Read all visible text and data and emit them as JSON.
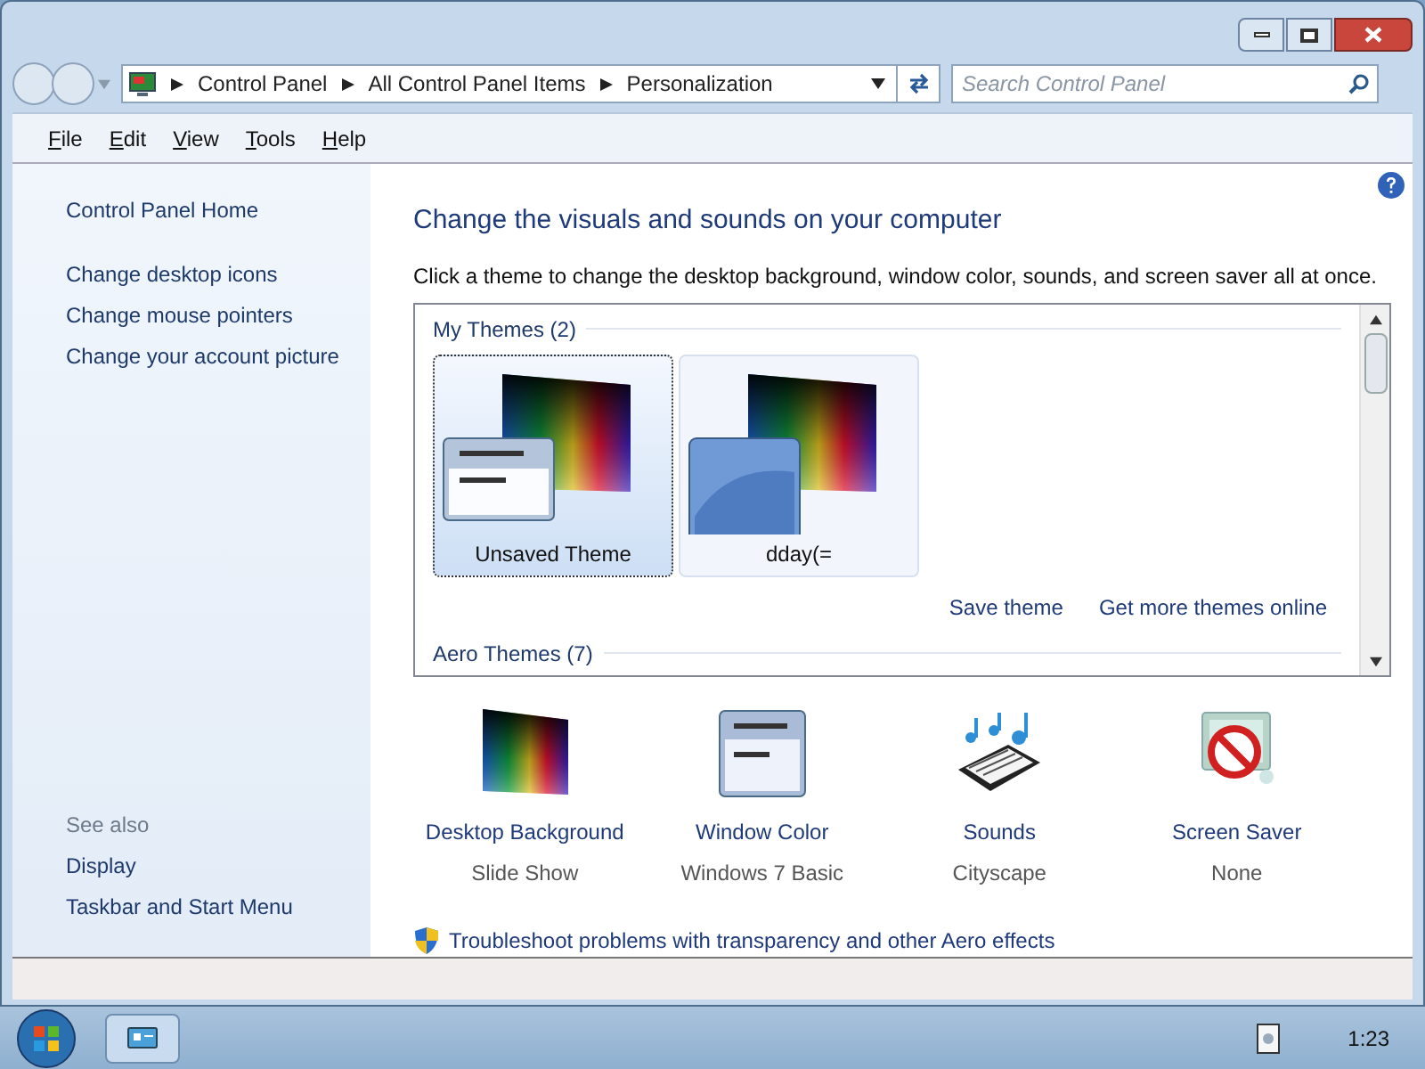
{
  "address_bar": {
    "breadcrumbs": [
      "Control Panel",
      "All Control Panel Items",
      "Personalization"
    ]
  },
  "search": {
    "placeholder": "Search Control Panel"
  },
  "menu": [
    "File",
    "Edit",
    "View",
    "Tools",
    "Help"
  ],
  "sidebar": {
    "links": [
      "Control Panel Home",
      "Change desktop icons",
      "Change mouse pointers",
      "Change your account picture"
    ],
    "see_also_title": "See also",
    "see_also": [
      "Display",
      "Taskbar and Start Menu"
    ]
  },
  "heading": "Change the visuals and sounds on your computer",
  "instruction": "Click a theme to change the desktop background, window color, sounds, and screen saver all at once.",
  "theme_groups": [
    {
      "title": "My Themes (2)",
      "themes": [
        {
          "name": "Unsaved Theme",
          "selected": true,
          "kind": "basic"
        },
        {
          "name": "dday(=",
          "selected": false,
          "kind": "aero"
        }
      ]
    },
    {
      "title": "Aero Themes (7)"
    }
  ],
  "theme_links": [
    "Save theme",
    "Get more themes online"
  ],
  "settings": [
    {
      "kind": "background",
      "label": "Desktop Background",
      "value": "Slide Show"
    },
    {
      "kind": "color",
      "label": "Window Color",
      "value": "Windows 7 Basic"
    },
    {
      "kind": "sounds",
      "label": "Sounds",
      "value": "Cityscape"
    },
    {
      "kind": "saver",
      "label": "Screen Saver",
      "value": "None"
    }
  ],
  "troubleshoot_link": "Troubleshoot problems with transparency and other Aero effects",
  "taskbar": {
    "clock": "1:23"
  }
}
